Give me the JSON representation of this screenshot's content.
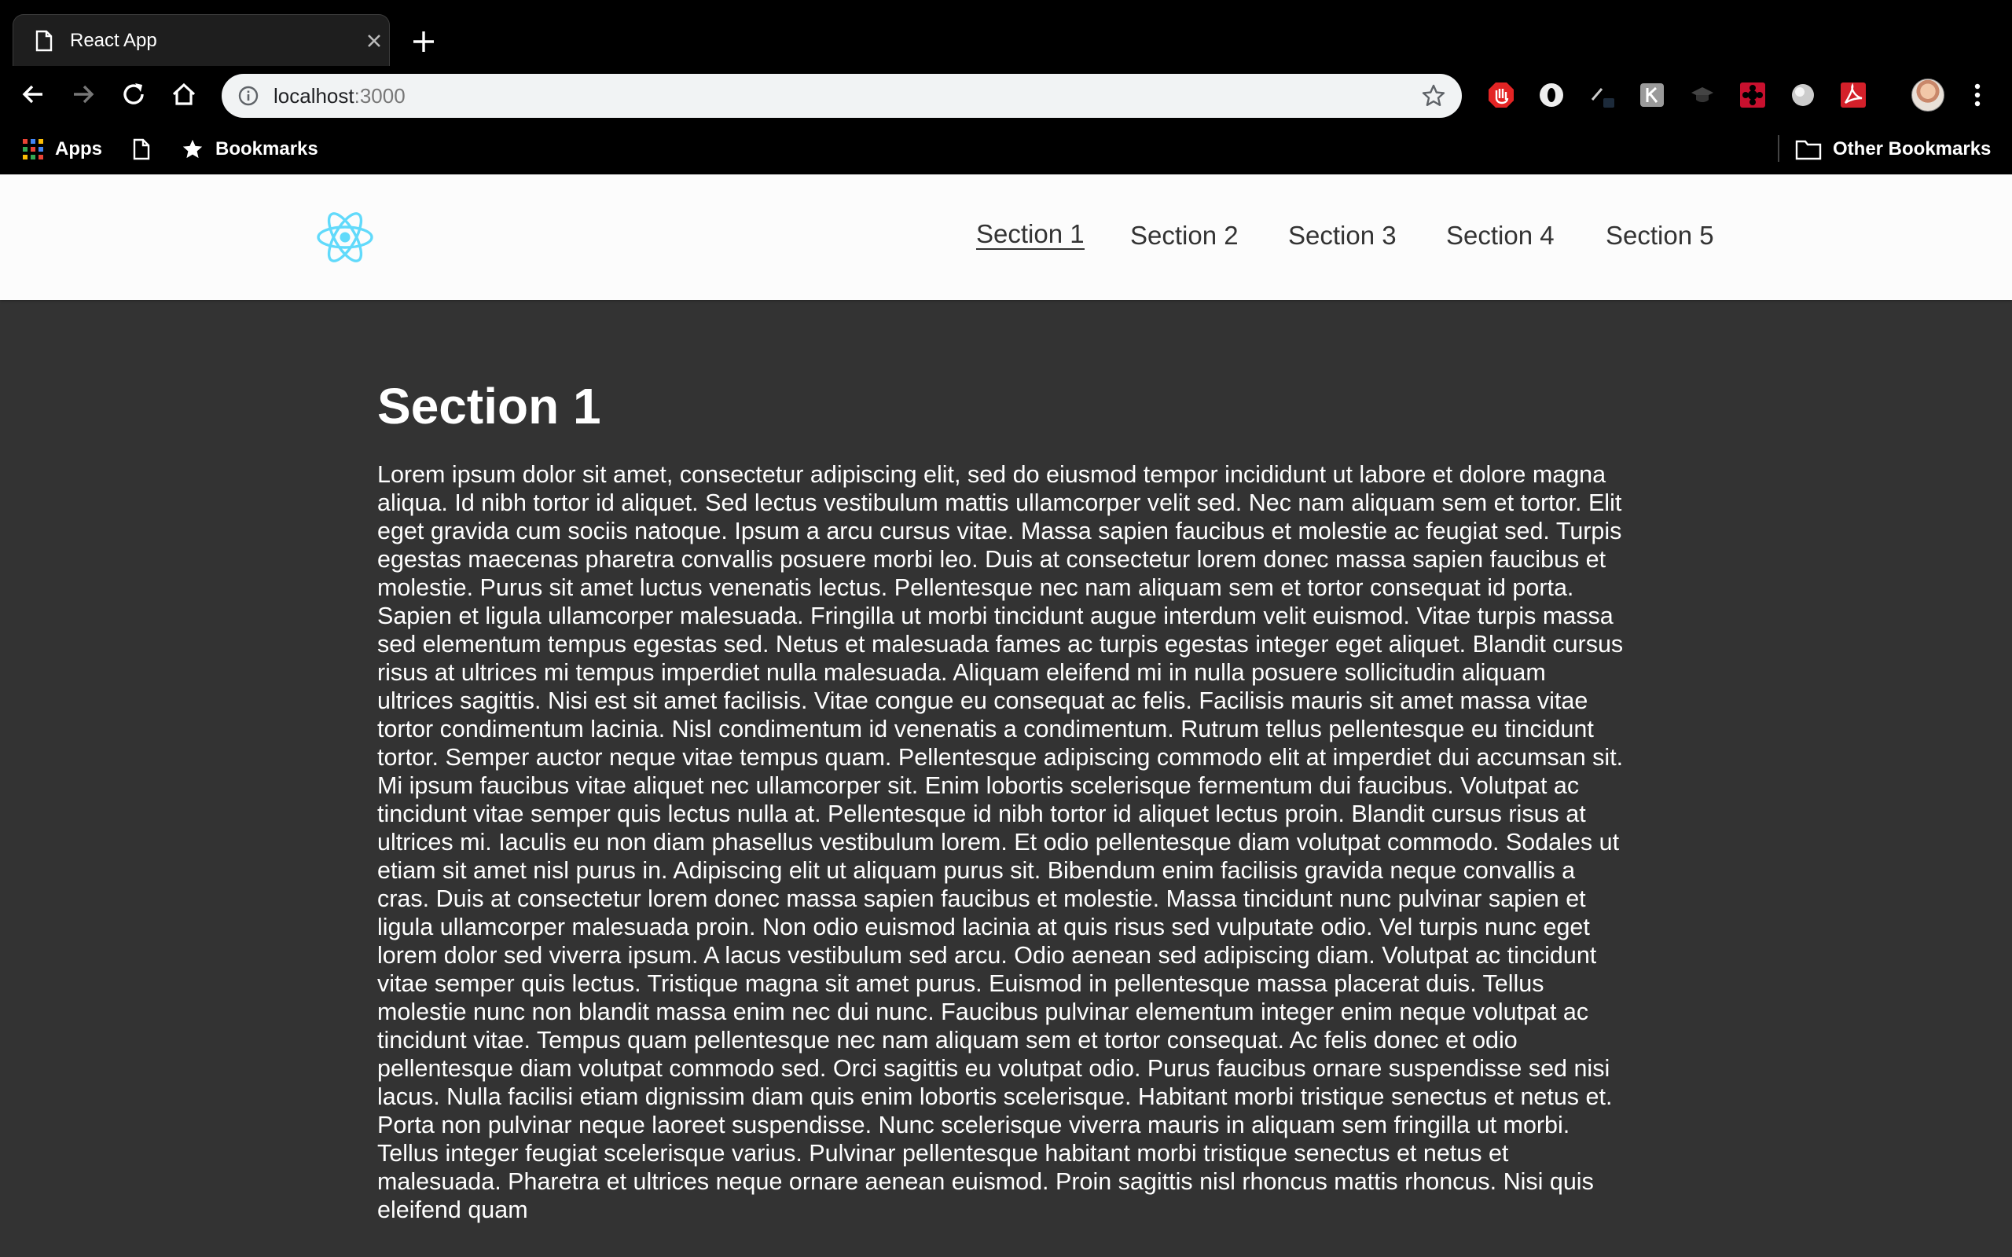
{
  "browser": {
    "tab": {
      "title": "React App"
    },
    "address": {
      "host": "localhost",
      "port": ":3000"
    },
    "bookmarks": {
      "apps_label": "Apps",
      "bookmarks_label": "Bookmarks",
      "other_label": "Other Bookmarks"
    }
  },
  "nav": {
    "items": [
      {
        "label": "Section 1",
        "active": true
      },
      {
        "label": "Section 2",
        "active": false
      },
      {
        "label": "Section 3",
        "active": false
      },
      {
        "label": "Section 4",
        "active": false
      },
      {
        "label": "Section 5",
        "active": false
      }
    ]
  },
  "section": {
    "title": "Section 1",
    "body": "Lorem ipsum dolor sit amet, consectetur adipiscing elit, sed do eiusmod tempor incididunt ut labore et dolore magna aliqua. Id nibh tortor id aliquet. Sed lectus vestibulum mattis ullamcorper velit sed. Nec nam aliquam sem et tortor. Elit eget gravida cum sociis natoque. Ipsum a arcu cursus vitae. Massa sapien faucibus et molestie ac feugiat sed. Turpis egestas maecenas pharetra convallis posuere morbi leo. Duis at consectetur lorem donec massa sapien faucibus et molestie. Purus sit amet luctus venenatis lectus. Pellentesque nec nam aliquam sem et tortor consequat id porta. Sapien et ligula ullamcorper malesuada. Fringilla ut morbi tincidunt augue interdum velit euismod. Vitae turpis massa sed elementum tempus egestas sed. Netus et malesuada fames ac turpis egestas integer eget aliquet. Blandit cursus risus at ultrices mi tempus imperdiet nulla malesuada. Aliquam eleifend mi in nulla posuere sollicitudin aliquam ultrices sagittis. Nisi est sit amet facilisis. Vitae congue eu consequat ac felis. Facilisis mauris sit amet massa vitae tortor condimentum lacinia. Nisl condimentum id venenatis a condimentum. Rutrum tellus pellentesque eu tincidunt tortor. Semper auctor neque vitae tempus quam. Pellentesque adipiscing commodo elit at imperdiet dui accumsan sit. Mi ipsum faucibus vitae aliquet nec ullamcorper sit. Enim lobortis scelerisque fermentum dui faucibus. Volutpat ac tincidunt vitae semper quis lectus nulla at. Pellentesque id nibh tortor id aliquet lectus proin. Blandit cursus risus at ultrices mi. Iaculis eu non diam phasellus vestibulum lorem. Et odio pellentesque diam volutpat commodo. Sodales ut etiam sit amet nisl purus in. Adipiscing elit ut aliquam purus sit. Bibendum enim facilisis gravida neque convallis a cras. Duis at consectetur lorem donec massa sapien faucibus et molestie. Massa tincidunt nunc pulvinar sapien et ligula ullamcorper malesuada proin. Non odio euismod lacinia at quis risus sed vulputate odio. Vel turpis nunc eget lorem dolor sed viverra ipsum. A lacus vestibulum sed arcu. Odio aenean sed adipiscing diam. Volutpat ac tincidunt vitae semper quis lectus. Tristique magna sit amet purus. Euismod in pellentesque massa placerat duis. Tellus molestie nunc non blandit massa enim nec dui nunc. Faucibus pulvinar elementum integer enim neque volutpat ac tincidunt vitae. Tempus quam pellentesque nec nam aliquam sem et tortor consequat. Ac felis donec et odio pellentesque diam volutpat commodo sed. Orci sagittis eu volutpat odio. Purus faucibus ornare suspendisse sed nisi lacus. Nulla facilisi etiam dignissim diam quis enim lobortis scelerisque. Habitant morbi tristique senectus et netus et. Porta non pulvinar neque laoreet suspendisse. Nunc scelerisque viverra mauris in aliquam sem fringilla ut morbi. Tellus integer feugiat scelerisque varius. Pulvinar pellentesque habitant morbi tristique senectus et netus et malesuada. Pharetra et ultrices neque ornare aenean euismod. Proin sagittis nisl rhoncus mattis rhoncus. Nisi quis eleifend quam"
  },
  "colors": {
    "chrome_bg": "#000000",
    "navbar_bg": "#fcfcfc",
    "content_bg": "#333333",
    "react_logo": "#61dafb"
  },
  "icons": {
    "tab_favicon": "page-icon",
    "tab_close": "close-icon",
    "new_tab": "plus-icon",
    "back": "arrow-left-icon",
    "forward": "arrow-right-icon",
    "reload": "reload-icon",
    "home": "home-icon",
    "site_info": "info-icon",
    "bookmark_star": "star-icon",
    "menu": "more-vert-icon",
    "logo": "react-logo-icon"
  }
}
